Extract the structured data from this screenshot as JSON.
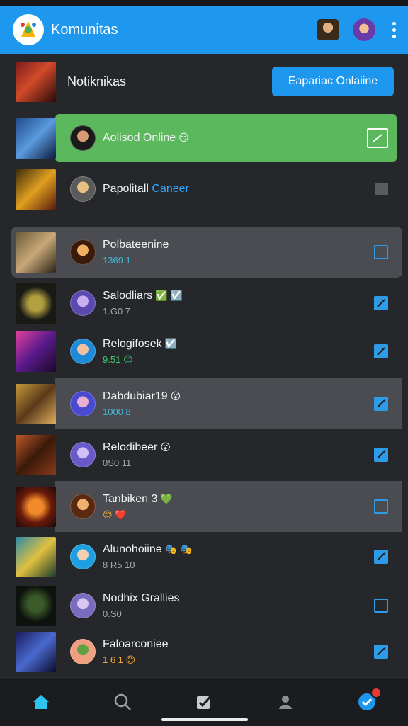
{
  "app": {
    "title": "Komunitas",
    "icons": [
      "logo-icon",
      "user-avatar-1",
      "user-avatar-2",
      "more-vert-icon"
    ]
  },
  "header": {
    "title": "Notiknikas",
    "button_label": "Eapariac Onlaiine"
  },
  "rows": [
    {
      "name": "Aolisod Online",
      "emoji": "😏",
      "sub": "",
      "state": "green-checked"
    },
    {
      "name": "Papolitall",
      "accent": "Caneer",
      "sub": "",
      "state": "gray"
    },
    {
      "name": "Polbateenine",
      "sub": "1369 1",
      "sub_color": "cyan",
      "state": "unchecked"
    },
    {
      "name": "Salodliars",
      "emoji": "✅ ☑️",
      "sub": "1.G0 7",
      "sub_color": "gray",
      "state": "checked"
    },
    {
      "name": "Relogifosek",
      "emoji": "☑️",
      "sub": "9.51",
      "sub_emoji": "😊",
      "sub_color": "green",
      "state": "checked"
    },
    {
      "name": "Dabdubiar19",
      "emoji": "😮",
      "sub": "1000 8",
      "sub_color": "cyan",
      "state": "checked"
    },
    {
      "name": "Relodibeer",
      "emoji": "😮",
      "sub": "0S0 11",
      "sub_color": "gray",
      "state": "checked"
    },
    {
      "name": "Tanbiken 3",
      "emoji": "💚",
      "sub": "😊",
      "sub_emoji": "❤️",
      "sub_color": "orange",
      "state": "unchecked"
    },
    {
      "name": "Alunohoiine",
      "emoji": "🎭 🎭",
      "sub": "8 R5 10",
      "sub_color": "gray",
      "state": "checked"
    },
    {
      "name": "Nodhix Grallies",
      "sub": "0.S0",
      "sub_color": "gray",
      "state": "unchecked"
    },
    {
      "name": "Faloarconiee",
      "sub": "1 6 1",
      "sub_emoji": "😊",
      "sub_color": "orange",
      "state": "checked"
    }
  ],
  "bottom_nav": [
    "home-icon",
    "search-icon",
    "tasks-icon",
    "profile-icon",
    "notifications-check-icon"
  ],
  "colors": {
    "accent": "#1e97ee",
    "background": "#26272b",
    "highlight": "#4a4c52",
    "green_row": "#5cb85c"
  }
}
